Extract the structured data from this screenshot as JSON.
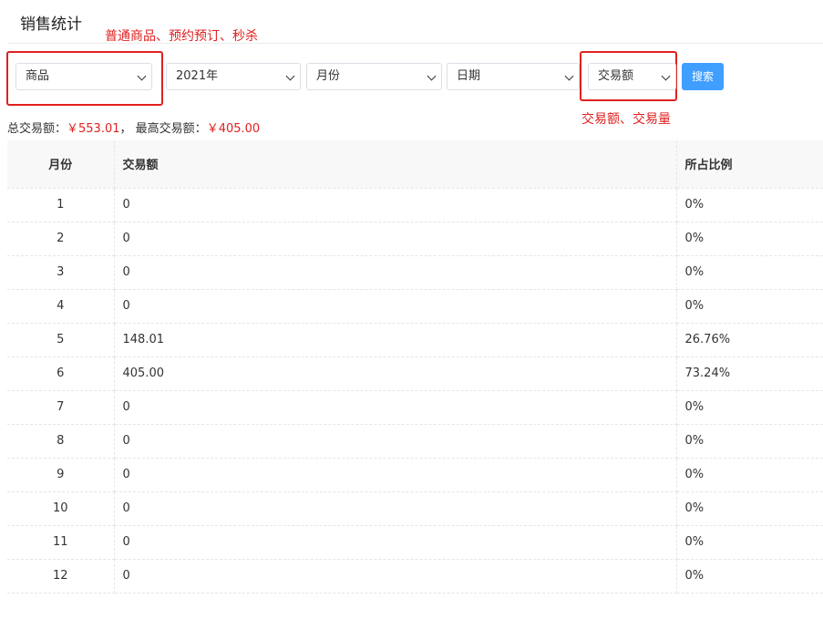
{
  "page": {
    "title": "销售统计"
  },
  "annotations": {
    "product_types": "普通商品、预约预订、秒杀",
    "metric_types": "交易额、交易量"
  },
  "filters": {
    "product": "商品",
    "year": "2021年",
    "month": "月份",
    "date": "日期",
    "metric": "交易额",
    "search_label": "搜索"
  },
  "summary": {
    "total_label": "总交易额：",
    "total_value": "￥553.01",
    "separator": "，",
    "max_label": "最高交易额：",
    "max_value": "￥405.00"
  },
  "table": {
    "headers": {
      "month": "月份",
      "amount": "交易额",
      "ratio": "所占比例"
    },
    "rows": [
      {
        "month": "1",
        "amount": "0",
        "ratio": "0%"
      },
      {
        "month": "2",
        "amount": "0",
        "ratio": "0%"
      },
      {
        "month": "3",
        "amount": "0",
        "ratio": "0%"
      },
      {
        "month": "4",
        "amount": "0",
        "ratio": "0%"
      },
      {
        "month": "5",
        "amount": "148.01",
        "ratio": "26.76%"
      },
      {
        "month": "6",
        "amount": "405.00",
        "ratio": "73.24%"
      },
      {
        "month": "7",
        "amount": "0",
        "ratio": "0%"
      },
      {
        "month": "8",
        "amount": "0",
        "ratio": "0%"
      },
      {
        "month": "9",
        "amount": "0",
        "ratio": "0%"
      },
      {
        "month": "10",
        "amount": "0",
        "ratio": "0%"
      },
      {
        "month": "11",
        "amount": "0",
        "ratio": "0%"
      },
      {
        "month": "12",
        "amount": "0",
        "ratio": "0%"
      }
    ]
  },
  "colors": {
    "accent": "#409eff",
    "annotation": "#e02020",
    "header_bg": "#f8f8f8"
  },
  "icons": {
    "dropdown": "chevron-down-icon"
  }
}
